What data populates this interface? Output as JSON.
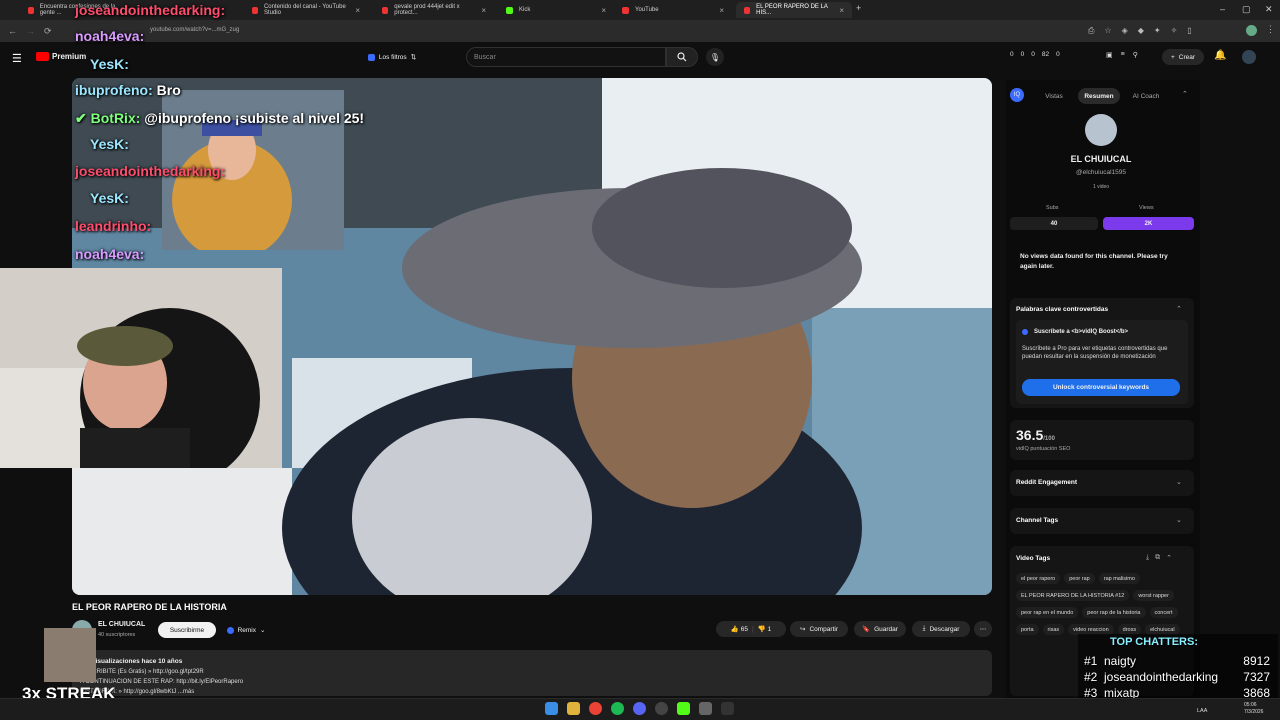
{
  "browser": {
    "tabs": [
      {
        "label": "Encuentra confesiones de la gente ...",
        "active": false
      },
      {
        "label": "Contenido del canal - YouTube Studio",
        "active": false
      },
      {
        "label": "qevale prod 444jet edit x protect...",
        "active": false
      },
      {
        "label": "Kick",
        "active": false
      },
      {
        "label": "YouTube",
        "active": false
      },
      {
        "label": "EL PEOR RAPERO DE LA HIS...",
        "active": true
      }
    ],
    "address": "youtube.com/watch?v=...mG_zug"
  },
  "youtube": {
    "logo": "Premium",
    "filters_label": "Los filtros",
    "search_placeholder": "Buscar",
    "create_label": "Crear",
    "ext_counts": [
      "0",
      "0",
      "0",
      "82",
      "0"
    ]
  },
  "chat_overlay": [
    {
      "user": "joseandointhedarking:",
      "msg": "",
      "color": "#ff4d6d"
    },
    {
      "user": "noah4eva:",
      "msg": "",
      "color": "#d89bff"
    },
    {
      "user": "YesK:",
      "msg": "",
      "color": "#9be7ff"
    },
    {
      "user": "ibuprofeno:",
      "msg": "Bro",
      "color": "#9be7ff"
    },
    {
      "user": "BotRix:",
      "msg": "@ibuprofeno ¡subiste al nivel 25!",
      "color": "#7dff7d"
    },
    {
      "user": "YesK:",
      "msg": "",
      "color": "#9be7ff"
    },
    {
      "user": "joseandointhedarking:",
      "msg": "",
      "color": "#ff4d6d"
    },
    {
      "user": "YesK:",
      "msg": "",
      "color": "#9be7ff"
    },
    {
      "user": "leandrinho:",
      "msg": "",
      "color": "#ff4d6d"
    },
    {
      "user": "noah4eva:",
      "msg": "",
      "color": "#d89bff"
    }
  ],
  "video": {
    "title": "EL PEOR RAPERO DE LA HISTORIA",
    "channel": "EL CHUIUCAL",
    "subs": "40 suscriptores",
    "subscribe": "Suscribirme",
    "remix": "Remix",
    "likes": "65",
    "dislikes": "1",
    "share": "Compartir",
    "save": "Guardar",
    "download": "Descargar",
    "desc_line1": "visualizaciones  hace 10 años",
    "desc_line2": "SUSCRIBITE (Es Gratis) » http://goo.gl/tpt29R",
    "desc_line3": "A CONTINUACION DE ESTE RAP: http://bit.ly/ElPeorRapero",
    "desc_line4": "INSTAGRAM: » http://goo.gl/8wbKtJ  ...más"
  },
  "streak": "3x STREAK",
  "vidiq": {
    "tabs": [
      "Vistas",
      "Resumen",
      "AI Coach"
    ],
    "channel_name": "EL CHUIUCAL",
    "handle": "@elchuiucal1595",
    "videos": "1 video",
    "subs_label": "Subs",
    "subs_value": "40",
    "views_label": "Views",
    "views_value": "2K",
    "no_data": "No views data found for this channel. Please try again later.",
    "kw_title": "Palabras clave controvertidas",
    "kw_sub": "Suscríbete a <b>vidIQ Boost</b>",
    "kw_desc": "Suscríbete a Pro para ver etiquetas controvertidas que puedan resultar en la suspensión de monetización",
    "kw_btn": "Unlock controversial keywords",
    "score": "36.5",
    "score_den": "/100",
    "score_label": "vidIQ puntuación SEO",
    "reddit": "Reddit Engagement",
    "channel_tags": "Channel Tags",
    "video_tags": "Video Tags",
    "tags": [
      "el peor rapero",
      "peor rap",
      "rap malisimo",
      "EL PEOR RAPERO DE LA HISTORIA #12",
      "worst rapper",
      "peor rap en el mundo",
      "peor rap de la historia",
      "concert",
      "porta",
      "risas",
      "video reaccion",
      "dross",
      "elchuiucal"
    ]
  },
  "top_chatters": {
    "title": "TOP CHATTERS:",
    "rows": [
      {
        "rank": "#1",
        "name": "naigty",
        "count": "8912"
      },
      {
        "rank": "#2",
        "name": "joseandointhedarking",
        "count": "7327"
      },
      {
        "rank": "#3",
        "name": "mixatp",
        "count": "3868"
      }
    ]
  },
  "taskbar": {
    "lang": "LAA",
    "date": "7/3/2026",
    "time": "05:06"
  }
}
